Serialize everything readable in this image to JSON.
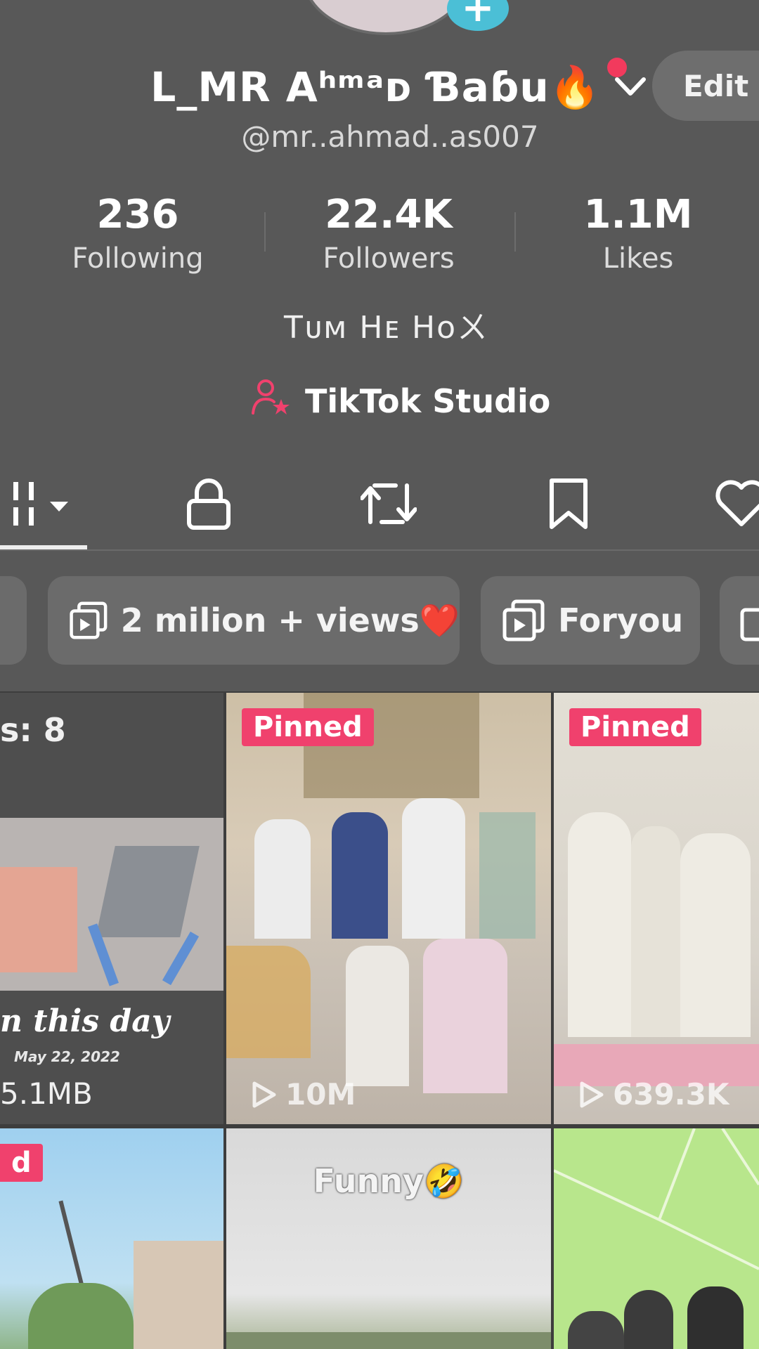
{
  "profile": {
    "display_name": "ᒪ_MR Aʰᵐᵃᴅ Ɓaɓu🔥",
    "handle": "@mr..ahmad..as007",
    "edit_label": "Edit",
    "bio": "Tᴜᴍ Hᴇ Hoㄨ",
    "studio_label": "TikTok Studio",
    "stats": [
      {
        "value": "236",
        "label": "Following"
      },
      {
        "value": "22.4K",
        "label": "Followers"
      },
      {
        "value": "1.1M",
        "label": "Likes"
      }
    ]
  },
  "tabs": [
    {
      "name": "videos",
      "icon": "grid-icon",
      "active": true
    },
    {
      "name": "private",
      "icon": "lock-icon"
    },
    {
      "name": "reposts",
      "icon": "repost-icon"
    },
    {
      "name": "favorites",
      "icon": "bookmark-icon"
    },
    {
      "name": "liked",
      "icon": "heart-icon"
    }
  ],
  "collections": [
    {
      "label": "2 milion + views❤️",
      "icon": "collection-icon"
    },
    {
      "label": "Foryou",
      "icon": "collection-icon"
    }
  ],
  "grid": {
    "drafts_label": "s: 8",
    "memory_title": "n this day",
    "memory_date": "May 22, 2022",
    "memory_size": "5.1MB",
    "pinned_label": "Pinned",
    "video2_views": "10M",
    "video3_views": "639.3K",
    "row2_partial_label": "d",
    "funny_caption": "Funny🤣"
  },
  "colors": {
    "background": "#585858",
    "accent_pink": "#f0416d",
    "plus_badge": "#4bbfd6"
  }
}
